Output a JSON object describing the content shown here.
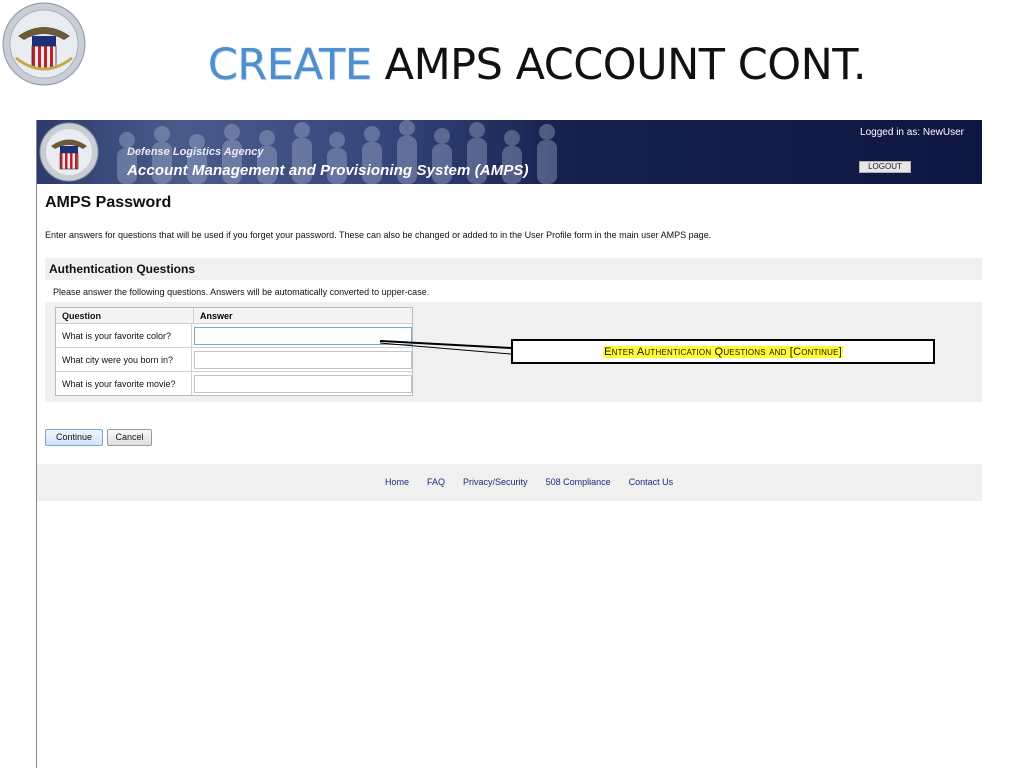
{
  "slide": {
    "title_highlight": "CREATE",
    "title_rest": " AMPS ACCOUNT CONT."
  },
  "header": {
    "agency": "Defense Logistics Agency",
    "system": "Account Management and Provisioning System (AMPS)",
    "logged_in": "Logged in as: NewUser",
    "logout_label": "LOGOUT"
  },
  "page": {
    "title": "AMPS Password",
    "intro": "Enter answers for questions that will be used if you forget your password. These can also be changed or added to in the User Profile form in the main user AMPS page."
  },
  "auth": {
    "section_title": "Authentication Questions",
    "note": "Please answer the following questions.   Answers will be automatically converted to upper-case.",
    "col_question": "Question",
    "col_answer": "Answer",
    "questions": [
      "What is your favorite color?",
      "What city were you born in?",
      "What is your favorite movie?"
    ],
    "answers": [
      "",
      "",
      ""
    ]
  },
  "buttons": {
    "continue": "Continue",
    "cancel": "Cancel"
  },
  "footer": {
    "links": [
      "Home",
      "FAQ",
      "Privacy/Security",
      "508 Compliance",
      "Contact Us"
    ]
  },
  "callout": {
    "text": "Enter Authentication Questions and [Continue]"
  },
  "colors": {
    "title_accent": "#4f8fd0",
    "header_bg": "#17224e",
    "callout_highlight": "#ffff33",
    "link": "#1a2b7a"
  },
  "icons": {
    "slide_seal": "dla-seal-icon",
    "app_seal": "dla-seal-icon"
  }
}
